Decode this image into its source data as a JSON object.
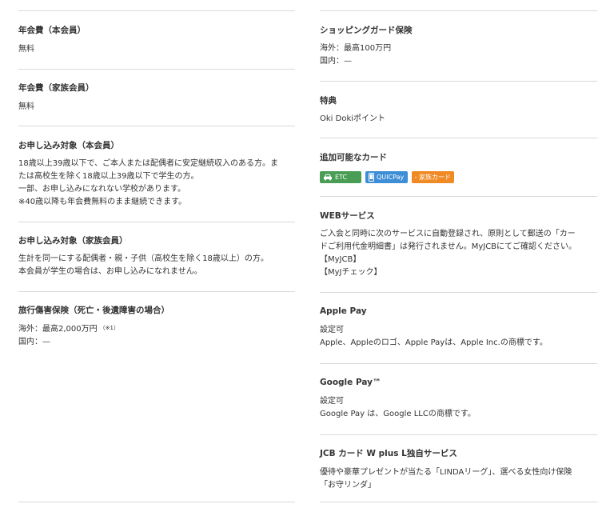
{
  "left": {
    "annual_fee_main": {
      "title": "年会費（本会員）",
      "value": "無料"
    },
    "annual_fee_family": {
      "title": "年会費（家族会員）",
      "value": "無料"
    },
    "eligibility_main": {
      "title": "お申し込み対象（本会員）",
      "lines": [
        "18歳以上39歳以下で、ご本人または配偶者に安定継続収入のある方。ま",
        "たは高校生を除く18歳以上39歳以下で学生の方。",
        "一部、お申し込みになれない学校があります。",
        "※40歳以降も年会費無料のまま継続できます。"
      ]
    },
    "eligibility_family": {
      "title": "お申し込み対象（家族会員）",
      "lines": [
        "生計を同一にする配偶者・親・子供（高校生を除く18歳以上）の方。",
        "本会員が学生の場合は、お申し込みになれません。"
      ]
    },
    "travel_insurance": {
      "title": "旅行傷害保険（死亡・後遺障害の場合）",
      "overseas": "海外：最高2,000万円",
      "note": "（※1）",
      "domestic": "国内：—"
    }
  },
  "right": {
    "shopping_guard": {
      "title": "ショッピングガード保険",
      "lines": [
        "海外：最高100万円",
        "国内：—"
      ]
    },
    "perks": {
      "title": "特典",
      "value": "Oki Dokiポイント"
    },
    "addable_cards": {
      "title": "追加可能なカード",
      "badges": [
        {
          "label": "ETC",
          "icon": "car-icon",
          "color": "#4a9d55"
        },
        {
          "label": "QUICPay",
          "icon": "phone-icon",
          "color": "#3d8ed6"
        },
        {
          "label": "家族カード",
          "icon": "family-icon",
          "color": "#f08a25"
        }
      ]
    },
    "web_service": {
      "title": "WEBサービス",
      "lines": [
        "ご入会と同時に次のサービスに自動登録され、原則として郵送の「カー",
        "ドご利用代金明細書」は発行されません。MyJCBにてご確認ください。",
        "【MyJCB】",
        "【MyJチェック】"
      ]
    },
    "apple_pay": {
      "title": "Apple Pay",
      "lines": [
        "設定可",
        "Apple、Appleのロゴ、Apple Payは、Apple Inc.の商標です。"
      ]
    },
    "google_pay": {
      "title": "Google Pay™",
      "lines": [
        "設定可",
        "Google Pay は、Google LLCの商標です。"
      ]
    },
    "w_plus_l": {
      "title": "JCB カード W plus L独自サービス",
      "lines": [
        "優待や豪華プレゼントが当たる「LINDAリーグ」、選べる女性向け保険",
        "「お守リンダ」"
      ]
    }
  }
}
